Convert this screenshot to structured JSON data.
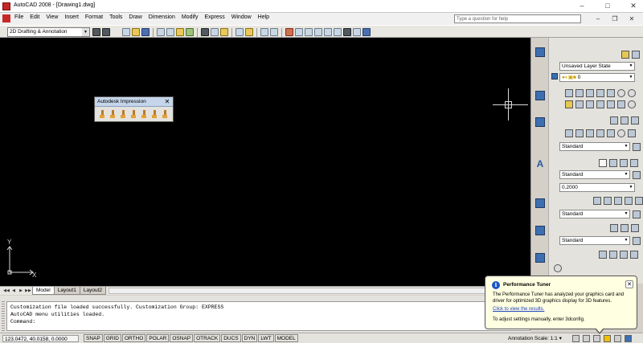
{
  "window": {
    "title": "AutoCAD 2008 - [Drawing1.dwg]",
    "minimize": "–",
    "maximize": "□",
    "close": "✕"
  },
  "menu": {
    "items": [
      "File",
      "Edit",
      "View",
      "Insert",
      "Format",
      "Tools",
      "Draw",
      "Dimension",
      "Modify",
      "Express",
      "Window",
      "Help"
    ],
    "help_placeholder": "Type a question for help",
    "doc_minimize": "–",
    "doc_restore": "❐",
    "doc_close": "✕"
  },
  "toolbar": {
    "workspace": "2D Drafting & Annotation"
  },
  "impression": {
    "title": "Autodesk Impression",
    "close": "✕"
  },
  "ucs": {
    "x_label": "X",
    "y_label": "Y"
  },
  "tabs": {
    "nav": [
      "◀◀",
      "◀",
      "▶",
      "▶▶"
    ],
    "items": [
      "Model",
      "Layout1",
      "Layout2"
    ],
    "active": "Model"
  },
  "dashboard": {
    "layer_state": "Unsaved Layer State",
    "layer": "0",
    "dim_style": "Standard",
    "text_style": "Standard",
    "text_height": "0.2000",
    "mleader_style": "Standard",
    "table_style": "Standard"
  },
  "command": {
    "lines": [
      "Customization file loaded successfully. Customization Group: EXPRESS",
      "AutoCAD menu utilities loaded.",
      "Command:"
    ]
  },
  "status": {
    "coords": "123.0472, 40.0158, 0.0000",
    "toggles": [
      "SNAP",
      "GRID",
      "ORTHO",
      "POLAR",
      "OSNAP",
      "OTRACK",
      "DUCS",
      "DYN",
      "LWT",
      "MODEL"
    ],
    "annotation_scale": "Annotation Scale:  1:1 ▾"
  },
  "bubble": {
    "title": "Performance Tuner",
    "body": "The Performance Tuner has analyzed your graphics card and driver for optimized 3D graphics display for 3D features.",
    "link": "Click to view the results.",
    "note": "To adjust settings manually, enter 3dconfig.",
    "close": "✕",
    "info_glyph": "i"
  },
  "colors": {
    "canvas": "#000000",
    "chrome": "#d4d0c8",
    "bubble": "#ffffe1",
    "link": "#1a3fbf"
  }
}
